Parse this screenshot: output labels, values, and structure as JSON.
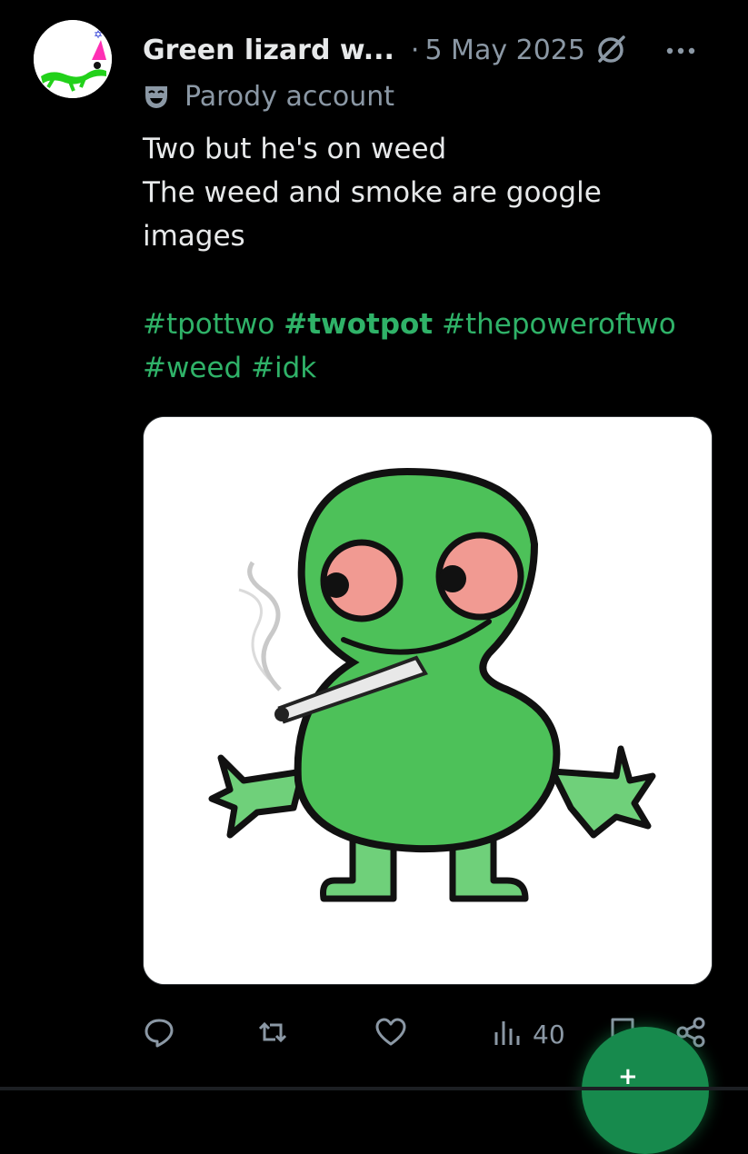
{
  "post": {
    "author_name": "Green lizard w...",
    "date_separator": "·",
    "date": "5 May 2025",
    "parody_label": "Parody account",
    "text_lines": [
      "Two but he's on weed",
      "The weed and smoke are google",
      "images"
    ],
    "hashtags": [
      "#tpottwo",
      "#twotpot",
      "#thepoweroftwo",
      "#weed",
      "#idk"
    ],
    "views": "40",
    "fab_symbol": "+"
  },
  "colors": {
    "background": "#000000",
    "text_primary": "#e7e9ea",
    "text_secondary": "#8b98a5",
    "hashtag": "#2fb268",
    "fab": "#178a4d"
  },
  "icons": {
    "verified_like": "grok-icon",
    "more": "more-dots-icon",
    "parody": "mask-icon",
    "reply": "reply-icon",
    "repost": "repost-icon",
    "like": "heart-icon",
    "views": "views-bar-icon",
    "bookmark": "bookmark-icon",
    "share": "share-icon"
  }
}
